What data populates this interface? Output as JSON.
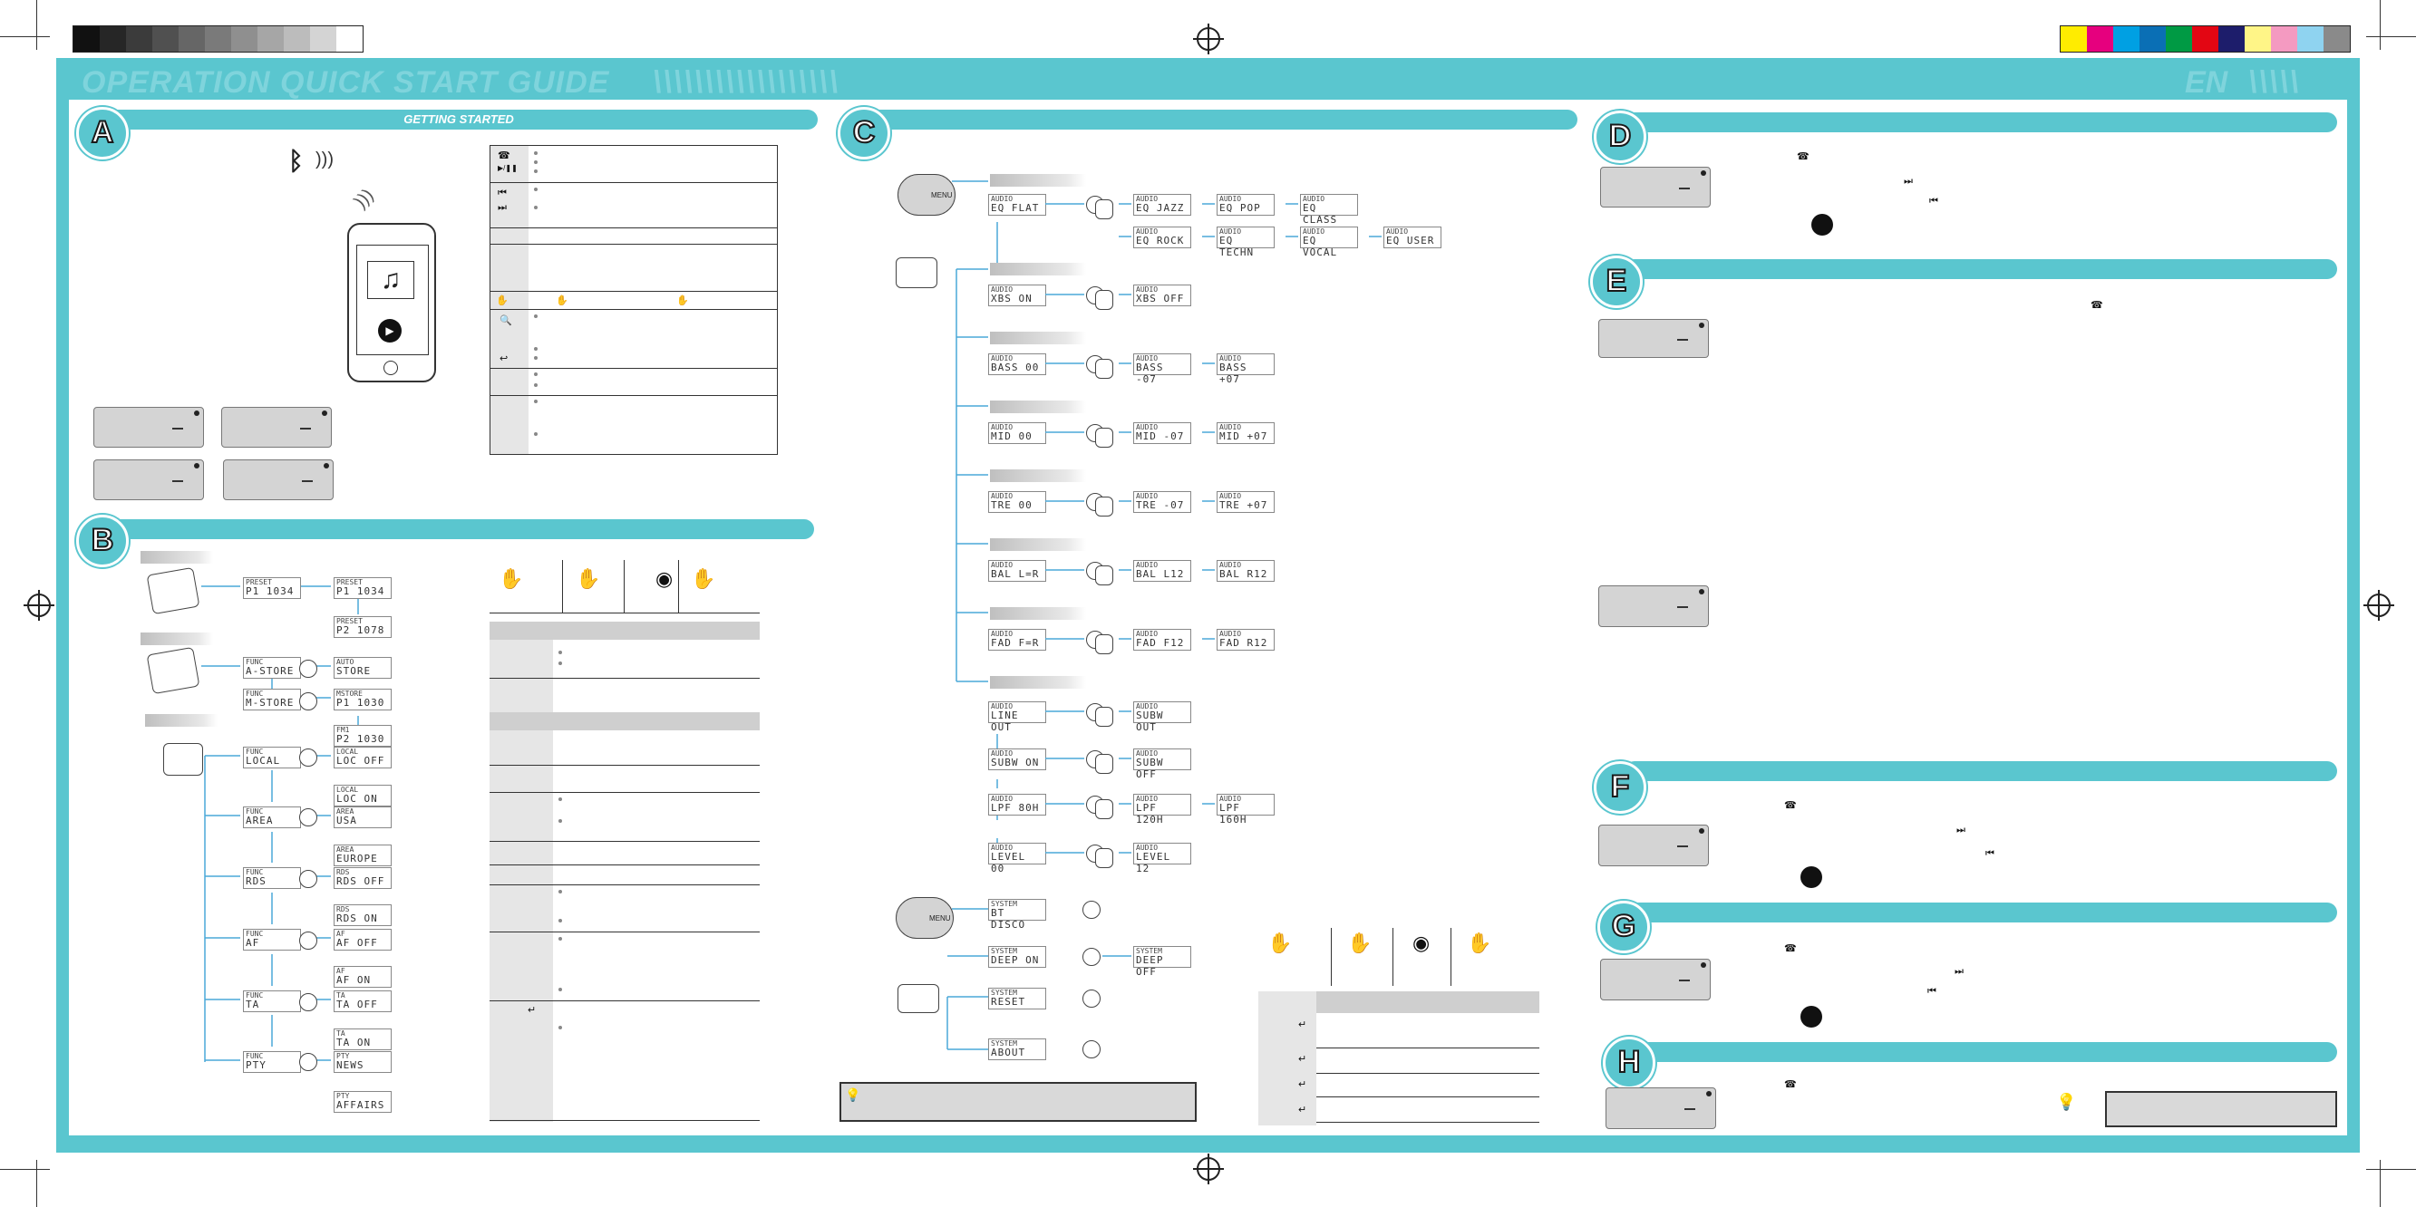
{
  "header": {
    "title": "OPERATION QUICK START GUIDE",
    "slashes": "\\\\\\\\\\\\\\\\\\\\\\\\\\\\\\\\\\\\",
    "language": "EN",
    "lang_slashes": "\\\\\\\\\\"
  },
  "sections": {
    "a": {
      "letter": "A",
      "title": "GETTING STARTED"
    },
    "b": {
      "letter": "B",
      "title": ""
    },
    "c": {
      "letter": "C",
      "title": ""
    },
    "d": {
      "letter": "D",
      "title": ""
    },
    "e": {
      "letter": "E",
      "title": ""
    },
    "f": {
      "letter": "F",
      "title": ""
    },
    "g": {
      "letter": "G",
      "title": ""
    },
    "h": {
      "letter": "H",
      "title": ""
    }
  },
  "colors": {
    "accent": "#5ac6cf",
    "arrow": "#4aa9d8",
    "lcd": "#d4d4d4",
    "grey_swatches": [
      "#111111",
      "#262626",
      "#3b3b3b",
      "#505050",
      "#666666",
      "#7a7a7a",
      "#8f8f8f",
      "#a6a6a6",
      "#bcbcbc",
      "#d4d4d4",
      "#ffffff"
    ],
    "color_swatches": [
      "#ffec00",
      "#e6007e",
      "#00a0e3",
      "#0a6fb5",
      "#009a44",
      "#e30613",
      "#1d1d6b",
      "#fff587",
      "#f49ac1",
      "#8fd3f0",
      "#8a8a8a"
    ]
  },
  "icons": {
    "bluetooth": "bluetooth-icon",
    "phone": "smartphone-icon",
    "music": "music-note-icon",
    "play": "play-icon",
    "menu_hand": "menu-press-hand-icon",
    "knob": "rotary-knob-icon",
    "lightbulb": "tip-lightbulb-icon"
  },
  "hand_labels": {
    "menu": "MENU"
  },
  "b_rows": [
    {
      "l1": "PRESET",
      "l2": "P1 1034"
    },
    {
      "l1": "FUNC",
      "l2": "A-STORE"
    },
    {
      "l1": "FUNC",
      "l2": "M-STORE"
    },
    {
      "l1": "FUNC",
      "l2": "LOCAL"
    },
    {
      "l1": "FUNC",
      "l2": "AREA"
    },
    {
      "l1": "FUNC",
      "l2": "RDS"
    },
    {
      "l1": "FUNC",
      "l2": "AF"
    },
    {
      "l1": "FUNC",
      "l2": "TA"
    },
    {
      "l1": "FUNC",
      "l2": "PTY"
    }
  ],
  "b_results": [
    {
      "l1": "PRESET",
      "l2": "P1 1034"
    },
    {
      "l1": "PRESET",
      "l2": "P2 1078"
    },
    {
      "l1": "AUTO",
      "l2": "STORE"
    },
    {
      "l1": "MSTORE",
      "l2": "P1 1030"
    },
    {
      "l1": "FM1",
      "l2": "P2 1030"
    },
    {
      "l1": "LOCAL",
      "l2": "LOC OFF"
    },
    {
      "l1": "LOCAL",
      "l2": "LOC ON"
    },
    {
      "l1": "AREA",
      "l2": "USA"
    },
    {
      "l1": "AREA",
      "l2": "EUROPE"
    },
    {
      "l1": "RDS",
      "l2": "RDS OFF"
    },
    {
      "l1": "RDS",
      "l2": "RDS ON"
    },
    {
      "l1": "AF",
      "l2": "AF OFF"
    },
    {
      "l1": "AF",
      "l2": "AF ON"
    },
    {
      "l1": "TA",
      "l2": "TA OFF"
    },
    {
      "l1": "TA",
      "l2": "TA ON"
    },
    {
      "l1": "PTY",
      "l2": "NEWS"
    },
    {
      "l1": "PTY",
      "l2": "AFFAIRS"
    }
  ],
  "c_rows": [
    {
      "start": {
        "l1": "AUDIO",
        "l2": "EQ FLAT"
      },
      "opts": [
        {
          "l1": "AUDIO",
          "l2": "EQ JAZZ"
        },
        {
          "l1": "AUDIO",
          "l2": "EQ POP"
        },
        {
          "l1": "AUDIO",
          "l2": "EQ CLASS"
        }
      ]
    },
    {
      "start": null,
      "opts": [
        {
          "l1": "AUDIO",
          "l2": "EQ ROCK"
        },
        {
          "l1": "AUDIO",
          "l2": "EQ TECHN"
        },
        {
          "l1": "AUDIO",
          "l2": "EQ VOCAL"
        },
        {
          "l1": "AUDIO",
          "l2": "EQ USER"
        }
      ]
    },
    {
      "start": {
        "l1": "AUDIO",
        "l2": "XBS ON"
      },
      "opts": [
        {
          "l1": "AUDIO",
          "l2": "XBS OFF"
        }
      ]
    },
    {
      "start": {
        "l1": "AUDIO",
        "l2": "BASS 00"
      },
      "opts": [
        {
          "l1": "AUDIO",
          "l2": "BASS -07"
        },
        {
          "l1": "AUDIO",
          "l2": "BASS +07"
        }
      ]
    },
    {
      "start": {
        "l1": "AUDIO",
        "l2": "MID 00"
      },
      "opts": [
        {
          "l1": "AUDIO",
          "l2": "MID -07"
        },
        {
          "l1": "AUDIO",
          "l2": "MID +07"
        }
      ]
    },
    {
      "start": {
        "l1": "AUDIO",
        "l2": "TRE 00"
      },
      "opts": [
        {
          "l1": "AUDIO",
          "l2": "TRE -07"
        },
        {
          "l1": "AUDIO",
          "l2": "TRE +07"
        }
      ]
    },
    {
      "start": {
        "l1": "AUDIO",
        "l2": "BAL L=R"
      },
      "opts": [
        {
          "l1": "AUDIO",
          "l2": "BAL L12"
        },
        {
          "l1": "AUDIO",
          "l2": "BAL R12"
        }
      ]
    },
    {
      "start": {
        "l1": "AUDIO",
        "l2": "FAD F=R"
      },
      "opts": [
        {
          "l1": "AUDIO",
          "l2": "FAD F12"
        },
        {
          "l1": "AUDIO",
          "l2": "FAD R12"
        }
      ]
    },
    {
      "start": {
        "l1": "AUDIO",
        "l2": "LINE OUT"
      },
      "opts": [
        {
          "l1": "AUDIO",
          "l2": "SUBW OUT"
        }
      ]
    },
    {
      "start": {
        "l1": "AUDIO",
        "l2": "SUBW ON"
      },
      "opts": [
        {
          "l1": "AUDIO",
          "l2": "SUBW OFF"
        }
      ]
    },
    {
      "start": {
        "l1": "AUDIO",
        "l2": "LPF 80H"
      },
      "opts": [
        {
          "l1": "AUDIO",
          "l2": "LPF 120H"
        },
        {
          "l1": "AUDIO",
          "l2": "LPF 160H"
        }
      ]
    },
    {
      "start": {
        "l1": "AUDIO",
        "l2": "LEVEL 00"
      },
      "opts": [
        {
          "l1": "AUDIO",
          "l2": "LEVEL 12"
        }
      ]
    }
  ],
  "c_system": [
    {
      "l1": "SYSTEM",
      "l2": "BT DISCO"
    },
    {
      "l1": "SYSTEM",
      "l2": "DEEP ON",
      "opt": {
        "l1": "SYSTEM",
        "l2": "DEEP OFF"
      }
    },
    {
      "l1": "SYSTEM",
      "l2": "RESET"
    },
    {
      "l1": "SYSTEM",
      "l2": "ABOUT"
    }
  ]
}
